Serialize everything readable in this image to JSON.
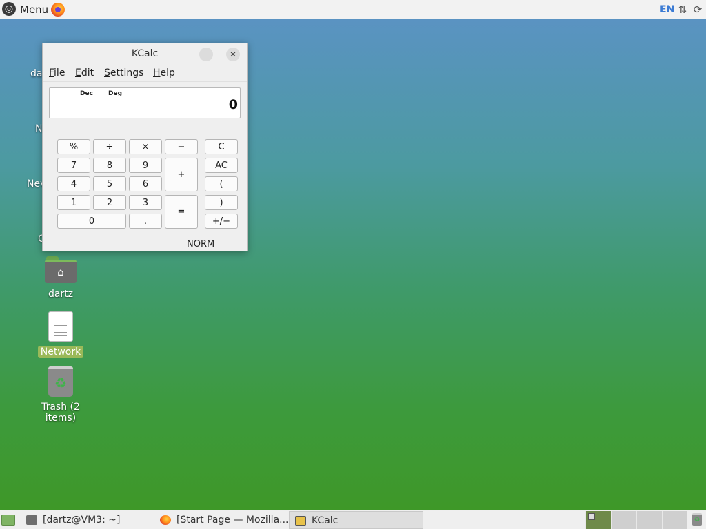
{
  "top_panel": {
    "menu_label": "Menu",
    "logo_icon": "ubuntu-logo-icon",
    "launchers": [
      "firefox-icon"
    ],
    "keyboard_layout": "EN",
    "tray_icons": [
      "network-icon",
      "updates-icon"
    ]
  },
  "desktop": {
    "icons": [
      {
        "name": "dartz",
        "type": "home-folder",
        "selected": false
      },
      {
        "name": "Network",
        "type": "document",
        "selected": true
      },
      {
        "name": "Trash (2 items)",
        "type": "trash",
        "selected": false
      }
    ],
    "partially_hidden_labels": [
      "da",
      "N",
      "Nev",
      "C"
    ]
  },
  "kcalc": {
    "title": "KCalc",
    "menu": [
      "File",
      "Edit",
      "Settings",
      "Help"
    ],
    "display": {
      "base_flag": "Dec",
      "angle_flag": "Deg",
      "value": "0"
    },
    "keys": {
      "percent": "%",
      "divide": "÷",
      "multiply": "×",
      "minus": "−",
      "clear": "C",
      "seven": "7",
      "eight": "8",
      "nine": "9",
      "plus": "+",
      "all_clear": "AC",
      "four": "4",
      "five": "5",
      "six": "6",
      "open_paren": "(",
      "one": "1",
      "two": "2",
      "three": "3",
      "equals": "=",
      "close_paren": ")",
      "zero": "0",
      "decimal": ".",
      "sign": "+/−"
    },
    "mode": "NORM"
  },
  "taskbar": {
    "tasks": [
      {
        "label": "[dartz@VM3: ~]",
        "icon": "terminal-icon",
        "active": false
      },
      {
        "label": "[Start Page — Mozilla...",
        "icon": "firefox-icon",
        "active": false
      },
      {
        "label": "KCalc",
        "icon": "kcalc-icon",
        "active": true
      }
    ],
    "workspaces": 4,
    "current_workspace": 1
  }
}
